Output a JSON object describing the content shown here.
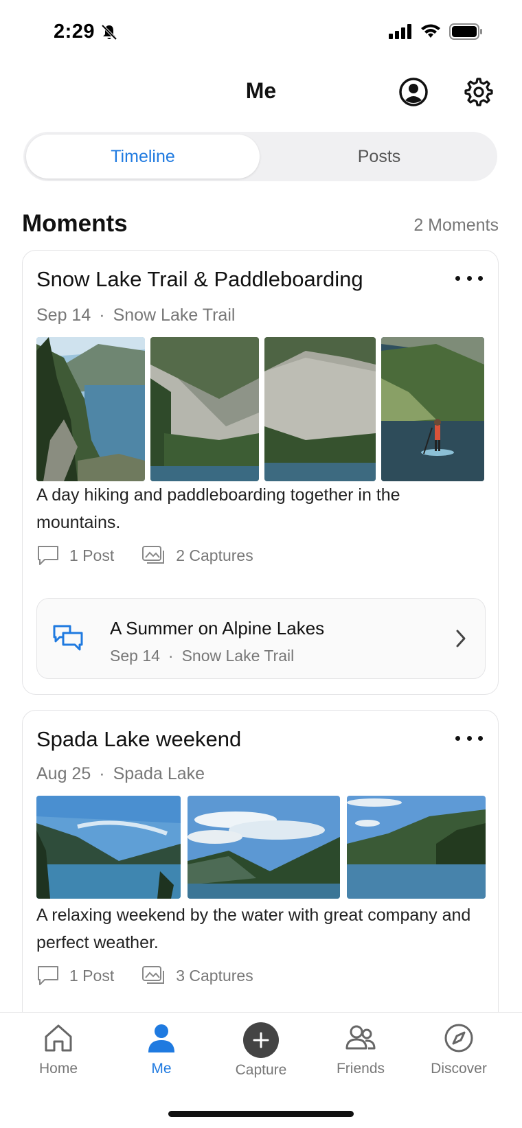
{
  "status": {
    "time": "2:29",
    "icons": [
      "bell-slash-icon",
      "signal-icon",
      "wifi-icon",
      "battery-icon"
    ]
  },
  "header": {
    "title": "Me",
    "profile_icon": "person-circle-icon",
    "settings_icon": "gear-icon"
  },
  "segments": {
    "timeline": "Timeline",
    "posts": "Posts",
    "selected": "Timeline"
  },
  "moments": {
    "title": "Moments",
    "count": "2 Moments",
    "cards": [
      {
        "title": "Snow Lake Trail & Paddleboarding",
        "date": "Sep 14",
        "separator": "·",
        "location": "Snow Lake Trail",
        "description": "A day hiking and paddleboarding together in the mountains.",
        "posts": "1 Post",
        "captures": "2 Captures",
        "story": {
          "title": "A Summer on Alpine Lakes",
          "date": "Sep 14",
          "separator": "·",
          "location": "Snow Lake Trail"
        }
      },
      {
        "title": "Spada Lake weekend",
        "date": "Aug 25",
        "separator": "·",
        "location": "Spada Lake",
        "description": "A relaxing weekend by the water with great company and perfect weather.",
        "posts": "1 Post",
        "captures": "3 Captures"
      }
    ]
  },
  "tabbar": {
    "home": "Home",
    "me": "Me",
    "capture": "Capture",
    "friends": "Friends",
    "discover": "Discover",
    "active": "Me"
  },
  "colors": {
    "accent": "#1f7ae0",
    "muted": "#777777",
    "border": "#e4e4e6"
  }
}
